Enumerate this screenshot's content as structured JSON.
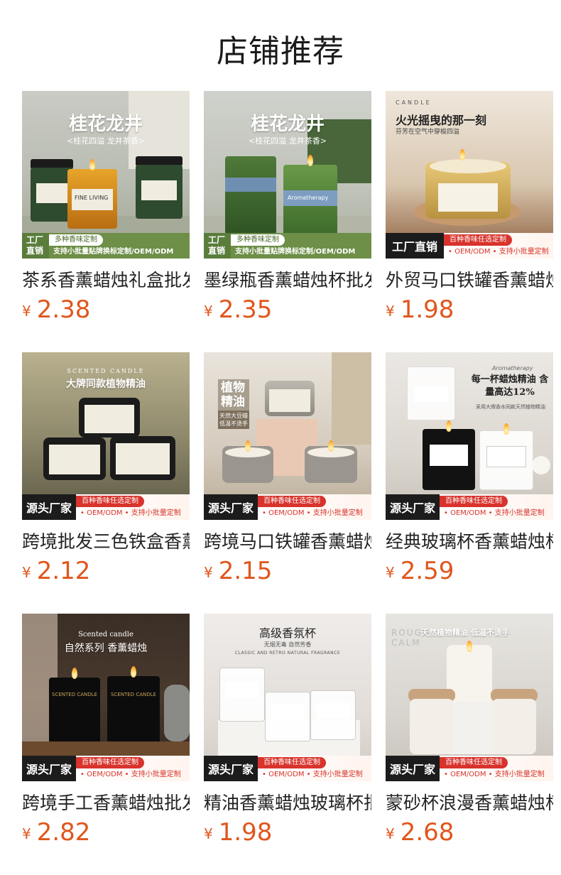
{
  "section_title": "店铺推荐",
  "products": [
    {
      "name": "茶系香薰蜡烛礼盒批发",
      "currency": "¥",
      "price": "2.38",
      "image": {
        "headline": "桂花龙井",
        "subline": "<桂花四溢 龙井茶香>",
        "jar_text": "FINE LIVING",
        "banner_style": "green",
        "banner_left_top": "工厂",
        "banner_left_bottom": "直销",
        "banner_top": "多种香味定制",
        "banner_bottom": "支持小批量贴牌换标定制/OEM/ODM"
      }
    },
    {
      "name": "墨绿瓶香薰蜡烛杯批发",
      "currency": "¥",
      "price": "2.35",
      "image": {
        "headline": "桂花龙井",
        "subline": "<桂花四溢 龙井茶香>",
        "jar_text": "Aromatherapy",
        "banner_style": "green",
        "banner_left_top": "工厂",
        "banner_left_bottom": "直销",
        "banner_top": "多种香味定制",
        "banner_bottom": "支持小批量贴牌换标定制/OEM/ODM"
      }
    },
    {
      "name": "外贸马口铁罐香薰蜡烛",
      "currency": "¥",
      "price": "1.98",
      "image": {
        "headline": "火光摇曳的那一刻",
        "subline": "芬芳在空气中穿梭四溢",
        "top_caption": "CANDLE",
        "banner_style": "red",
        "banner_left": "工厂直销",
        "banner_top": "百种香味任选定制",
        "banner_bottom": "• OEM/ODM • 支持小批量定制"
      }
    },
    {
      "name": "跨境批发三色铁盒香薰",
      "currency": "¥",
      "price": "2.12",
      "image": {
        "headline": "大牌同款植物精油",
        "top_caption": "SCENTED CANDLE",
        "banner_style": "red",
        "banner_left": "源头厂家",
        "banner_top": "百种香味任选定制",
        "banner_bottom": "• OEM/ODM • 支持小批量定制"
      }
    },
    {
      "name": "跨境马口铁罐香薰蜡烛",
      "currency": "¥",
      "price": "2.15",
      "image": {
        "headline": "植物精油",
        "subline": "天然大豆蜡 低温不烫手",
        "banner_style": "red",
        "banner_left": "源头厂家",
        "banner_top": "百种香味任选定制",
        "banner_bottom": "• OEM/ODM • 支持小批量定制"
      }
    },
    {
      "name": "经典玻璃杯香薰蜡烛杯",
      "currency": "¥",
      "price": "2.59",
      "image": {
        "headline": "每一杯蜡烛精油 含量高达12%",
        "subline": "采用大牌香水同款天然植物精油",
        "top_caption": "Aromatherapy",
        "banner_style": "red",
        "banner_left": "源头厂家",
        "banner_top": "百种香味任选定制",
        "banner_bottom": "• OEM/ODM • 支持小批量定制"
      }
    },
    {
      "name": "跨境手工香薰蜡烛批发",
      "currency": "¥",
      "price": "2.82",
      "image": {
        "headline": "自然系列 香薰蜡烛",
        "top_caption": "Scented candle",
        "jar_text": "SCENTED CANDLE",
        "banner_style": "red",
        "banner_left": "源头厂家",
        "banner_top": "百种香味任选定制",
        "banner_bottom": "• OEM/ODM • 支持小批量定制"
      }
    },
    {
      "name": "精油香薰蜡烛玻璃杯批",
      "currency": "¥",
      "price": "1.98",
      "image": {
        "headline": "高级香氛杯",
        "subline": "无烟无毒 自然芳香",
        "top_caption": "CLASSIC AND RETRO NATURAL FRAGRANCE",
        "banner_style": "red",
        "banner_left": "源头厂家",
        "banner_top": "百种香味任选定制",
        "banner_bottom": "• OEM/ODM • 支持小批量定制"
      }
    },
    {
      "name": "蒙砂杯浪漫香薰蜡烛杯",
      "currency": "¥",
      "price": "2.68",
      "image": {
        "headline": "天然植物精油 低温不烫手",
        "top_caption": "ROUGH CALM",
        "banner_style": "red",
        "banner_left": "源头厂家",
        "banner_top": "百种香味任选定制",
        "banner_bottom": "• OEM/ODM • 支持小批量定制"
      }
    }
  ]
}
